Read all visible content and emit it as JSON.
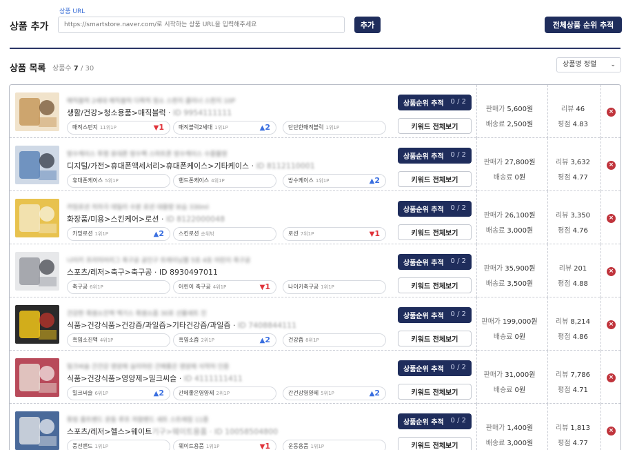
{
  "header": {
    "title": "상품 추가",
    "url_label": "상품 URL",
    "url_placeholder": "https://smartstore.naver.com/로 시작하는 상품 URL을 입력해주세요",
    "add_label": "추가",
    "track_all_label": "전체상품 순위 추적"
  },
  "list": {
    "title": "상품 목록",
    "count_label": "상품수",
    "count_current": "7",
    "count_total": "/ 30",
    "sort_label": "상품명 정렬"
  },
  "labels": {
    "track": "상품순위 추적",
    "keywords": "키워드 전체보기",
    "price": "판매가",
    "shipping": "배송료",
    "reviews": "리뷰",
    "rating": "평점"
  },
  "products": [
    {
      "name": "매직블럭 2세대 매직블럭 다목적 청소 스펀지 클리너 스펀지 10P",
      "category": "생활/건강>청소용품>매직블럭 · ",
      "pid": "ID 9954111111",
      "progress": "0 / 2",
      "price": "5,600원",
      "shipping": "2,500원",
      "reviews": "46",
      "rating": "4.83",
      "keywords": [
        {
          "name": "매직스펀지",
          "rank": "11위1P",
          "arrow": "▼",
          "change": "1",
          "dir": "down"
        },
        {
          "name": "매직블럭2세대",
          "rank": "1위1P",
          "arrow": "▲",
          "change": "2",
          "dir": "up"
        },
        {
          "name": "단단한매직블럭",
          "rank": "1위1P",
          "arrow": "",
          "change": "",
          "dir": ""
        }
      ],
      "thumb_colors": [
        "#c79a5e",
        "#f1e3cb",
        "#6b4a2a"
      ]
    },
    {
      "name": "방수케이스 투명 휴대폰 방수팩 스마트폰 방수케이스 수중촬영",
      "category": "디지털/가전>휴대폰액세서리>휴대폰케이스>기타케이스 · ",
      "pid": "ID 8112110001",
      "progress": "0 / 2",
      "price": "27,800원",
      "shipping": "0원",
      "reviews": "3,632",
      "rating": "4.77",
      "keywords": [
        {
          "name": "휴대폰케이스",
          "rank": "5위1P",
          "arrow": "",
          "change": "",
          "dir": ""
        },
        {
          "name": "핸드폰케이스",
          "rank": "4위1P",
          "arrow": "",
          "change": "",
          "dir": ""
        },
        {
          "name": "방수케이스",
          "rank": "1위1P",
          "arrow": "▲",
          "change": "2",
          "dir": "up"
        }
      ],
      "thumb_colors": [
        "#5f86b8",
        "#cfd9e6",
        "#2a2f3a"
      ]
    },
    {
      "name": "카밍로션 저자극 데일리 수분 로션 대용량 보습 330ml",
      "category": "화장품/미용>스킨케어>로션 · ",
      "pid": "ID 8122000048",
      "progress": "0 / 2",
      "price": "26,100원",
      "shipping": "3,000원",
      "reviews": "3,350",
      "rating": "4.76",
      "keywords": [
        {
          "name": "카밍로션",
          "rank": "1위1P",
          "arrow": "▲",
          "change": "2",
          "dir": "up"
        },
        {
          "name": "스킨로션",
          "rank": "순위밖",
          "arrow": "",
          "change": "",
          "dir": ""
        },
        {
          "name": "로션",
          "rank": "7위1P",
          "arrow": "▼",
          "change": "1",
          "dir": "down"
        }
      ],
      "thumb_colors": [
        "#f3e6bf",
        "#e8c24e",
        "#faf6ea"
      ]
    },
    {
      "name": "나이키 프리미어리그 축구공 공인구 트레이닝볼 5호 4호 어린이 축구공",
      "category": "스포츠/레저>축구>축구공 · ID 8930497011",
      "pid": "",
      "progress": "0 / 2",
      "price": "35,900원",
      "shipping": "3,500원",
      "reviews": "201",
      "rating": "4.88",
      "keywords": [
        {
          "name": "축구공",
          "rank": "6위1P",
          "arrow": "",
          "change": "",
          "dir": ""
        },
        {
          "name": "어린이 축구공",
          "rank": "4위1P",
          "arrow": "▼",
          "change": "1",
          "dir": "down"
        },
        {
          "name": "나이키축구공",
          "rank": "1위1P",
          "arrow": "",
          "change": "",
          "dir": ""
        }
      ],
      "thumb_colors": [
        "#9a9ca3",
        "#e7e8ea",
        "#3b3d44"
      ]
    },
    {
      "name": "건강한 흑염소진액 엑기스 흑염소즙 30포 선물세트 진",
      "category": "식품>건강식품>건강즙/과일즙>기타건강즙/과일즙 · ",
      "pid": "ID 7408844111",
      "progress": "0 / 2",
      "price": "199,000원",
      "shipping": "0원",
      "reviews": "8,214",
      "rating": "4.86",
      "keywords": [
        {
          "name": "흑염소진액",
          "rank": "4위1P",
          "arrow": "",
          "change": "",
          "dir": ""
        },
        {
          "name": "흑염소즙",
          "rank": "2위1P",
          "arrow": "▲",
          "change": "2",
          "dir": "up"
        },
        {
          "name": "건강즙",
          "rank": "8위1P",
          "arrow": "",
          "change": "",
          "dir": ""
        }
      ],
      "thumb_colors": [
        "#f0c419",
        "#2a2a2a",
        "#c8352b"
      ]
    },
    {
      "name": "밀크씨슬 간건강 영양제 실리마린 간에좋은 영양제 식약처 인증",
      "category": "식품>건강식품>영양제>밀크씨슬 · ",
      "pid": "ID 4111111411",
      "progress": "0 / 2",
      "price": "31,000원",
      "shipping": "0원",
      "reviews": "7,786",
      "rating": "4.71",
      "keywords": [
        {
          "name": "밀크씨슬",
          "rank": "6위1P",
          "arrow": "▲",
          "change": "2",
          "dir": "up"
        },
        {
          "name": "간에좋은영양제",
          "rank": "2위1P",
          "arrow": "",
          "change": "",
          "dir": ""
        },
        {
          "name": "간건강영양제",
          "rank": "5위1P",
          "arrow": "▲",
          "change": "2",
          "dir": "up"
        }
      ],
      "thumb_colors": [
        "#e6d7d0",
        "#b84a5a",
        "#f7f1ee"
      ]
    },
    {
      "name": "튜빙 홈트밴드 운동 루프 저항밴드 세트 스트레칭 11종",
      "category": "스포츠/레저>헬스>웨이트",
      "pid": "기구>웨이트용품 · ID 10058504800",
      "progress": "0 / 2",
      "price": "1,400원",
      "shipping": "3,000원",
      "reviews": "1,813",
      "rating": "4.77",
      "keywords": [
        {
          "name": "풍선밴드",
          "rank": "1위1P",
          "arrow": "",
          "change": "",
          "dir": ""
        },
        {
          "name": "웨이트용품",
          "rank": "1위1P",
          "arrow": "▼",
          "change": "1",
          "dir": "down"
        },
        {
          "name": "운동용품",
          "rank": "1위1P",
          "arrow": "",
          "change": "",
          "dir": ""
        }
      ],
      "thumb_colors": [
        "#d9dde3",
        "#4a6a9a",
        "#f4f5f7"
      ]
    }
  ]
}
